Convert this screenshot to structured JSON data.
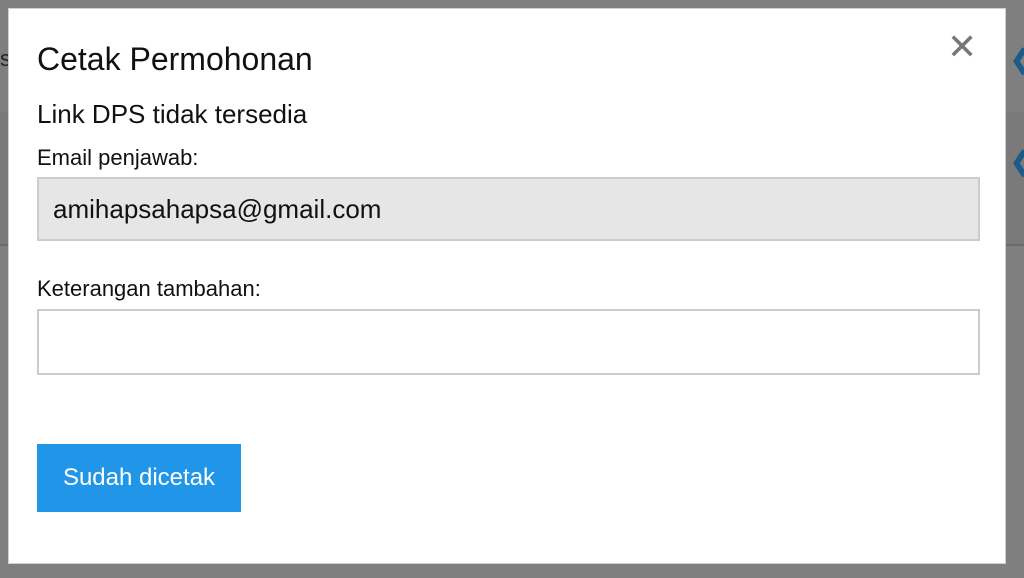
{
  "background": {
    "left_fragment": "s",
    "chevron_icon": "chevron-left-icon"
  },
  "dialog": {
    "title": "Cetak Permohonan",
    "close_icon": "close-icon",
    "close_glyph": "✕",
    "dps_status": "Link DPS tidak tersedia",
    "email_label": "Email penjawab:",
    "email_value": "amihapsahapsa@gmail.com",
    "note_label": "Keterangan tambahan:",
    "note_value": "",
    "note_placeholder": "",
    "primary_button": "Sudah dicetak"
  },
  "colors": {
    "overlay": "#7f7f7f",
    "primary": "#2196e8",
    "readonly_field": "#e6e6e6"
  }
}
